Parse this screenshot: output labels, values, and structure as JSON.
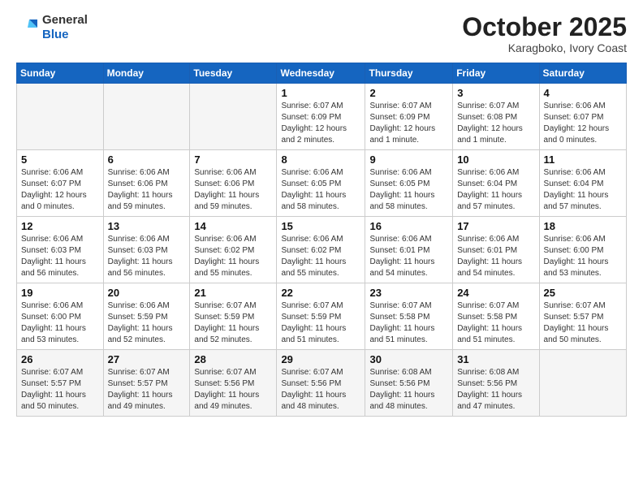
{
  "header": {
    "logo_line1": "General",
    "logo_line2": "Blue",
    "month": "October 2025",
    "location": "Karagboko, Ivory Coast"
  },
  "weekdays": [
    "Sunday",
    "Monday",
    "Tuesday",
    "Wednesday",
    "Thursday",
    "Friday",
    "Saturday"
  ],
  "weeks": [
    [
      {
        "day": "",
        "info": ""
      },
      {
        "day": "",
        "info": ""
      },
      {
        "day": "",
        "info": ""
      },
      {
        "day": "1",
        "info": "Sunrise: 6:07 AM\nSunset: 6:09 PM\nDaylight: 12 hours and 2 minutes."
      },
      {
        "day": "2",
        "info": "Sunrise: 6:07 AM\nSunset: 6:09 PM\nDaylight: 12 hours and 1 minute."
      },
      {
        "day": "3",
        "info": "Sunrise: 6:07 AM\nSunset: 6:08 PM\nDaylight: 12 hours and 1 minute."
      },
      {
        "day": "4",
        "info": "Sunrise: 6:06 AM\nSunset: 6:07 PM\nDaylight: 12 hours and 0 minutes."
      }
    ],
    [
      {
        "day": "5",
        "info": "Sunrise: 6:06 AM\nSunset: 6:07 PM\nDaylight: 12 hours and 0 minutes."
      },
      {
        "day": "6",
        "info": "Sunrise: 6:06 AM\nSunset: 6:06 PM\nDaylight: 11 hours and 59 minutes."
      },
      {
        "day": "7",
        "info": "Sunrise: 6:06 AM\nSunset: 6:06 PM\nDaylight: 11 hours and 59 minutes."
      },
      {
        "day": "8",
        "info": "Sunrise: 6:06 AM\nSunset: 6:05 PM\nDaylight: 11 hours and 58 minutes."
      },
      {
        "day": "9",
        "info": "Sunrise: 6:06 AM\nSunset: 6:05 PM\nDaylight: 11 hours and 58 minutes."
      },
      {
        "day": "10",
        "info": "Sunrise: 6:06 AM\nSunset: 6:04 PM\nDaylight: 11 hours and 57 minutes."
      },
      {
        "day": "11",
        "info": "Sunrise: 6:06 AM\nSunset: 6:04 PM\nDaylight: 11 hours and 57 minutes."
      }
    ],
    [
      {
        "day": "12",
        "info": "Sunrise: 6:06 AM\nSunset: 6:03 PM\nDaylight: 11 hours and 56 minutes."
      },
      {
        "day": "13",
        "info": "Sunrise: 6:06 AM\nSunset: 6:03 PM\nDaylight: 11 hours and 56 minutes."
      },
      {
        "day": "14",
        "info": "Sunrise: 6:06 AM\nSunset: 6:02 PM\nDaylight: 11 hours and 55 minutes."
      },
      {
        "day": "15",
        "info": "Sunrise: 6:06 AM\nSunset: 6:02 PM\nDaylight: 11 hours and 55 minutes."
      },
      {
        "day": "16",
        "info": "Sunrise: 6:06 AM\nSunset: 6:01 PM\nDaylight: 11 hours and 54 minutes."
      },
      {
        "day": "17",
        "info": "Sunrise: 6:06 AM\nSunset: 6:01 PM\nDaylight: 11 hours and 54 minutes."
      },
      {
        "day": "18",
        "info": "Sunrise: 6:06 AM\nSunset: 6:00 PM\nDaylight: 11 hours and 53 minutes."
      }
    ],
    [
      {
        "day": "19",
        "info": "Sunrise: 6:06 AM\nSunset: 6:00 PM\nDaylight: 11 hours and 53 minutes."
      },
      {
        "day": "20",
        "info": "Sunrise: 6:06 AM\nSunset: 5:59 PM\nDaylight: 11 hours and 52 minutes."
      },
      {
        "day": "21",
        "info": "Sunrise: 6:07 AM\nSunset: 5:59 PM\nDaylight: 11 hours and 52 minutes."
      },
      {
        "day": "22",
        "info": "Sunrise: 6:07 AM\nSunset: 5:59 PM\nDaylight: 11 hours and 51 minutes."
      },
      {
        "day": "23",
        "info": "Sunrise: 6:07 AM\nSunset: 5:58 PM\nDaylight: 11 hours and 51 minutes."
      },
      {
        "day": "24",
        "info": "Sunrise: 6:07 AM\nSunset: 5:58 PM\nDaylight: 11 hours and 51 minutes."
      },
      {
        "day": "25",
        "info": "Sunrise: 6:07 AM\nSunset: 5:57 PM\nDaylight: 11 hours and 50 minutes."
      }
    ],
    [
      {
        "day": "26",
        "info": "Sunrise: 6:07 AM\nSunset: 5:57 PM\nDaylight: 11 hours and 50 minutes."
      },
      {
        "day": "27",
        "info": "Sunrise: 6:07 AM\nSunset: 5:57 PM\nDaylight: 11 hours and 49 minutes."
      },
      {
        "day": "28",
        "info": "Sunrise: 6:07 AM\nSunset: 5:56 PM\nDaylight: 11 hours and 49 minutes."
      },
      {
        "day": "29",
        "info": "Sunrise: 6:07 AM\nSunset: 5:56 PM\nDaylight: 11 hours and 48 minutes."
      },
      {
        "day": "30",
        "info": "Sunrise: 6:08 AM\nSunset: 5:56 PM\nDaylight: 11 hours and 48 minutes."
      },
      {
        "day": "31",
        "info": "Sunrise: 6:08 AM\nSunset: 5:56 PM\nDaylight: 11 hours and 47 minutes."
      },
      {
        "day": "",
        "info": ""
      }
    ]
  ]
}
